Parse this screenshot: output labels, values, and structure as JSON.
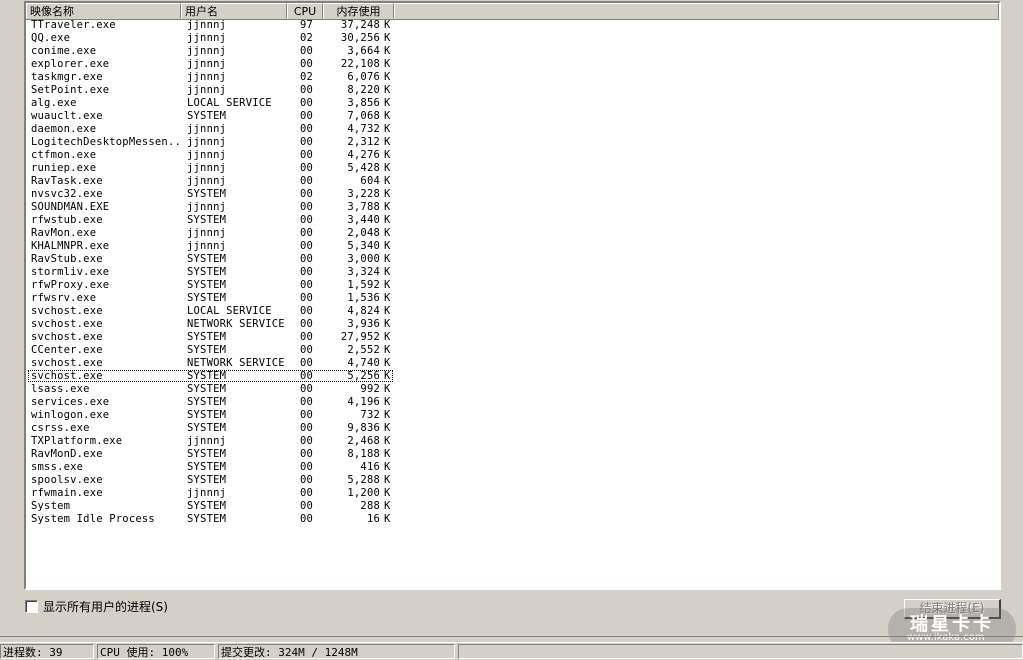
{
  "columns": {
    "name": "映像名称",
    "user": "用户名",
    "cpu": "CPU",
    "mem": "内存使用"
  },
  "processes": [
    {
      "name": "TTraveler.exe",
      "user": "jjnnnj",
      "cpu": "97",
      "mem": "37,248",
      "unit": "K"
    },
    {
      "name": "QQ.exe",
      "user": "jjnnnj",
      "cpu": "02",
      "mem": "30,256",
      "unit": "K"
    },
    {
      "name": "conime.exe",
      "user": "jjnnnj",
      "cpu": "00",
      "mem": "3,664",
      "unit": "K"
    },
    {
      "name": "explorer.exe",
      "user": "jjnnnj",
      "cpu": "00",
      "mem": "22,108",
      "unit": "K"
    },
    {
      "name": "taskmgr.exe",
      "user": "jjnnnj",
      "cpu": "02",
      "mem": "6,076",
      "unit": "K"
    },
    {
      "name": "SetPoint.exe",
      "user": "jjnnnj",
      "cpu": "00",
      "mem": "8,220",
      "unit": "K"
    },
    {
      "name": "alg.exe",
      "user": "LOCAL SERVICE",
      "cpu": "00",
      "mem": "3,856",
      "unit": "K"
    },
    {
      "name": "wuauclt.exe",
      "user": "SYSTEM",
      "cpu": "00",
      "mem": "7,068",
      "unit": "K"
    },
    {
      "name": "daemon.exe",
      "user": "jjnnnj",
      "cpu": "00",
      "mem": "4,732",
      "unit": "K"
    },
    {
      "name": "LogitechDesktopMessen...",
      "user": "jjnnnj",
      "cpu": "00",
      "mem": "2,312",
      "unit": "K"
    },
    {
      "name": "ctfmon.exe",
      "user": "jjnnnj",
      "cpu": "00",
      "mem": "4,276",
      "unit": "K"
    },
    {
      "name": "runiep.exe",
      "user": "jjnnnj",
      "cpu": "00",
      "mem": "5,428",
      "unit": "K"
    },
    {
      "name": "RavTask.exe",
      "user": "jjnnnj",
      "cpu": "00",
      "mem": "604",
      "unit": "K"
    },
    {
      "name": "nvsvc32.exe",
      "user": "SYSTEM",
      "cpu": "00",
      "mem": "3,228",
      "unit": "K"
    },
    {
      "name": "SOUNDMAN.EXE",
      "user": "jjnnnj",
      "cpu": "00",
      "mem": "3,788",
      "unit": "K"
    },
    {
      "name": "rfwstub.exe",
      "user": "SYSTEM",
      "cpu": "00",
      "mem": "3,440",
      "unit": "K"
    },
    {
      "name": "RavMon.exe",
      "user": "jjnnnj",
      "cpu": "00",
      "mem": "2,048",
      "unit": "K"
    },
    {
      "name": "KHALMNPR.exe",
      "user": "jjnnnj",
      "cpu": "00",
      "mem": "5,340",
      "unit": "K"
    },
    {
      "name": "RavStub.exe",
      "user": "SYSTEM",
      "cpu": "00",
      "mem": "3,000",
      "unit": "K"
    },
    {
      "name": "stormliv.exe",
      "user": "SYSTEM",
      "cpu": "00",
      "mem": "3,324",
      "unit": "K"
    },
    {
      "name": "rfwProxy.exe",
      "user": "SYSTEM",
      "cpu": "00",
      "mem": "1,592",
      "unit": "K"
    },
    {
      "name": "rfwsrv.exe",
      "user": "SYSTEM",
      "cpu": "00",
      "mem": "1,536",
      "unit": "K"
    },
    {
      "name": "svchost.exe",
      "user": "LOCAL SERVICE",
      "cpu": "00",
      "mem": "4,824",
      "unit": "K"
    },
    {
      "name": "svchost.exe",
      "user": "NETWORK SERVICE",
      "cpu": "00",
      "mem": "3,936",
      "unit": "K"
    },
    {
      "name": "svchost.exe",
      "user": "SYSTEM",
      "cpu": "00",
      "mem": "27,952",
      "unit": "K"
    },
    {
      "name": "CCenter.exe",
      "user": "SYSTEM",
      "cpu": "00",
      "mem": "2,552",
      "unit": "K"
    },
    {
      "name": "svchost.exe",
      "user": "NETWORK SERVICE",
      "cpu": "00",
      "mem": "4,740",
      "unit": "K"
    },
    {
      "name": "svchost.exe",
      "user": "SYSTEM",
      "cpu": "00",
      "mem": "5,256",
      "unit": "K",
      "focused": true
    },
    {
      "name": "lsass.exe",
      "user": "SYSTEM",
      "cpu": "00",
      "mem": "992",
      "unit": "K"
    },
    {
      "name": "services.exe",
      "user": "SYSTEM",
      "cpu": "00",
      "mem": "4,196",
      "unit": "K"
    },
    {
      "name": "winlogon.exe",
      "user": "SYSTEM",
      "cpu": "00",
      "mem": "732",
      "unit": "K"
    },
    {
      "name": "csrss.exe",
      "user": "SYSTEM",
      "cpu": "00",
      "mem": "9,836",
      "unit": "K"
    },
    {
      "name": "TXPlatform.exe",
      "user": "jjnnnj",
      "cpu": "00",
      "mem": "2,468",
      "unit": "K"
    },
    {
      "name": "RavMonD.exe",
      "user": "SYSTEM",
      "cpu": "00",
      "mem": "8,188",
      "unit": "K"
    },
    {
      "name": "smss.exe",
      "user": "SYSTEM",
      "cpu": "00",
      "mem": "416",
      "unit": "K"
    },
    {
      "name": "spoolsv.exe",
      "user": "SYSTEM",
      "cpu": "00",
      "mem": "5,288",
      "unit": "K"
    },
    {
      "name": "rfwmain.exe",
      "user": "jjnnnj",
      "cpu": "00",
      "mem": "1,200",
      "unit": "K"
    },
    {
      "name": "System",
      "user": "SYSTEM",
      "cpu": "00",
      "mem": "288",
      "unit": "K"
    },
    {
      "name": "System Idle Process",
      "user": "SYSTEM",
      "cpu": "00",
      "mem": "16",
      "unit": "K"
    }
  ],
  "show_all_users": {
    "label": "显示所有用户的进程(S)",
    "checked": false
  },
  "end_process_button": "结束进程(E)",
  "status": {
    "process_count": "进程数: 39",
    "cpu_usage": "CPU 使用: 100%",
    "commit_charge": "提交更改: 324M / 1248M"
  },
  "watermark": {
    "title": "瑞星卡卡",
    "url": "www.ikaka.com"
  },
  "colors": {
    "face": "#d4d0c8",
    "list_background": "#ffffff",
    "shadow": "#808080",
    "disabled_text": "#808080"
  }
}
